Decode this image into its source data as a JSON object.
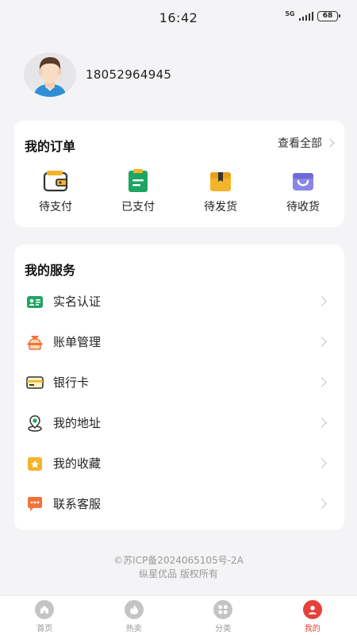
{
  "status": {
    "time": "16:42",
    "network": "5G",
    "battery": "68"
  },
  "profile": {
    "phone": "18052964945"
  },
  "orders": {
    "title": "我的订单",
    "view_all": "查看全部",
    "items": [
      {
        "label": "待支付",
        "icon": "wallet-icon"
      },
      {
        "label": "已支付",
        "icon": "clipboard-icon"
      },
      {
        "label": "待发货",
        "icon": "package-icon"
      },
      {
        "label": "待收货",
        "icon": "shopping-bag-icon"
      }
    ]
  },
  "services": {
    "title": "我的服务",
    "items": [
      {
        "label": "实名认证",
        "icon": "id-card-icon"
      },
      {
        "label": "账单管理",
        "icon": "money-bag-icon"
      },
      {
        "label": "银行卡",
        "icon": "bank-card-icon"
      },
      {
        "label": "我的地址",
        "icon": "location-pin-icon"
      },
      {
        "label": "我的收藏",
        "icon": "star-folder-icon"
      },
      {
        "label": "联系客服",
        "icon": "chat-bubble-icon"
      }
    ]
  },
  "footer": {
    "line1": "©苏ICP备2024065105号-2A",
    "line2": "纵星优品 版权所有"
  },
  "tabs": [
    {
      "label": "首页",
      "icon": "home-icon"
    },
    {
      "label": "热卖",
      "icon": "flame-icon"
    },
    {
      "label": "分类",
      "icon": "grid-icon"
    },
    {
      "label": "我的",
      "icon": "user-icon"
    }
  ],
  "colors": {
    "accent": "#e5413a",
    "background": "#f4f4f6",
    "card": "#ffffff"
  }
}
